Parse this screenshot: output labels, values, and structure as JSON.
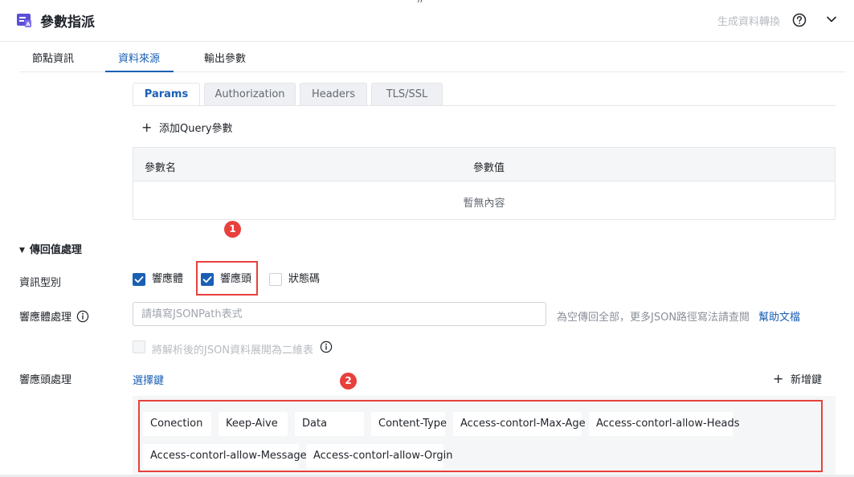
{
  "header": {
    "title": "參數指派",
    "convert_label": "生成資料轉換",
    "top_marker": "//"
  },
  "icons": {
    "app": "form-app-icon",
    "help": "question-circle-icon",
    "collapse": "chevron-down-icon"
  },
  "tabs": [
    {
      "label": "節點資訊",
      "active": false
    },
    {
      "label": "資料來源",
      "active": true
    },
    {
      "label": "輸出參數",
      "active": false
    }
  ],
  "subtabs": [
    {
      "label": "Params",
      "active": true
    },
    {
      "label": "Authorization",
      "active": false
    },
    {
      "label": "Headers",
      "active": false
    },
    {
      "label": "TLS/SSL",
      "active": false
    }
  ],
  "params": {
    "add_label": "添加Query參數",
    "columns": [
      "參數名",
      "參數值"
    ],
    "empty_text": "暫無內容"
  },
  "annotations": [
    "1",
    "2"
  ],
  "response": {
    "section_title": "傳回值處理",
    "type_label": "資訊型別",
    "types": [
      {
        "label": "響應體",
        "checked": true
      },
      {
        "label": "響應頭",
        "checked": true
      },
      {
        "label": "狀態碼",
        "checked": false
      }
    ],
    "body_label": "響應體處理",
    "jsonpath_placeholder": "請填寫JSONPath表式",
    "jsonpath_value": "",
    "hint": "為空傳回全部，更多JSON路徑寫法請查閱",
    "help_link": "幫助文檔",
    "flatten_label": "將解析後的JSON資料展開為二維表",
    "flatten_checked": false,
    "header_label": "響應頭處理",
    "select_key": "選擇鍵",
    "add_key": "新增鍵",
    "keys": [
      "Conection",
      "Keep-Aive",
      "Data",
      "Content-Type",
      "Access-contorl-Max-Age",
      "Access-contorl-allow-Heads",
      "Access-contorl-allow-Message",
      "Access-contorl-allow-Orgin"
    ]
  },
  "colors": {
    "accent": "#1a5fb4",
    "annotation": "#e8403c",
    "muted": "#b8bcc2"
  }
}
